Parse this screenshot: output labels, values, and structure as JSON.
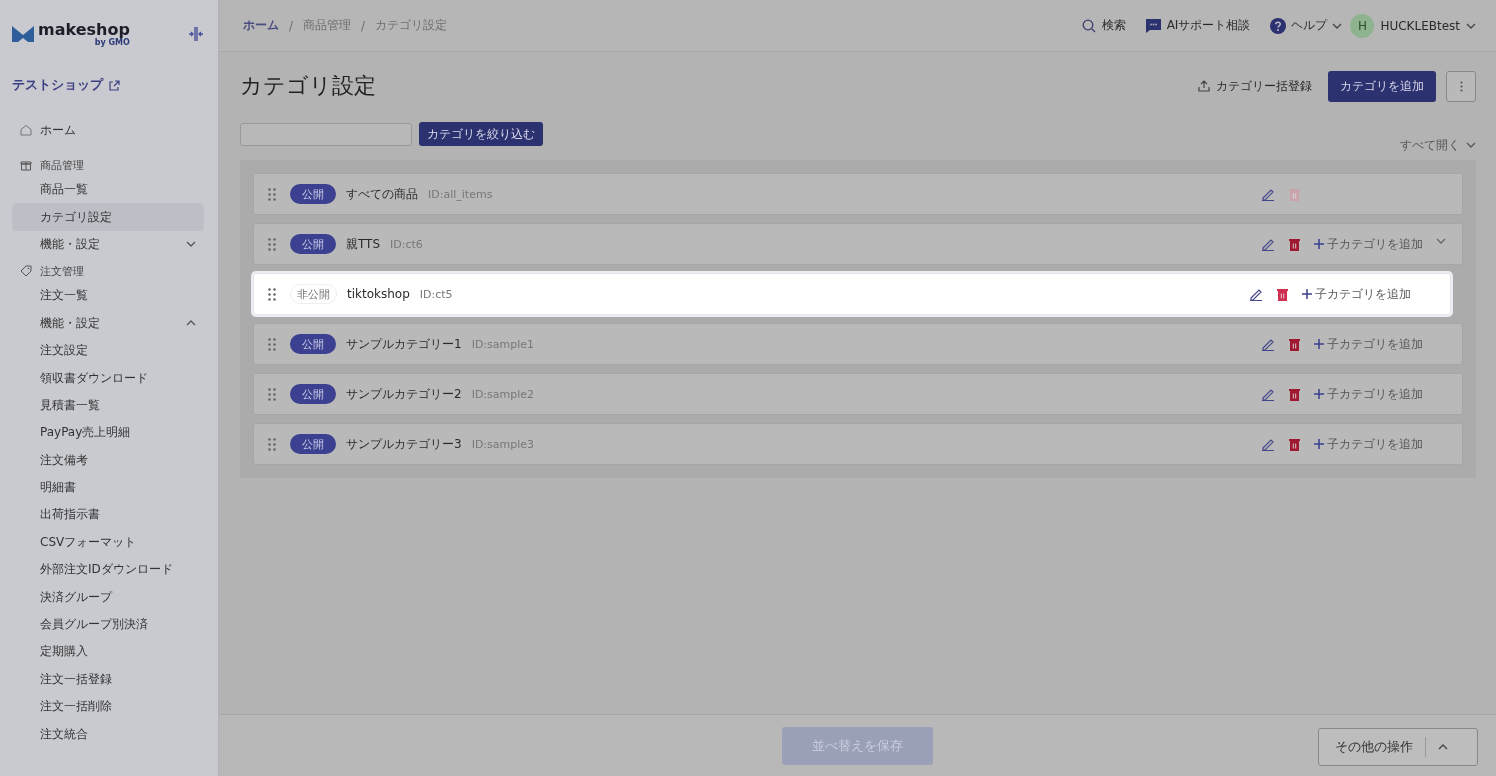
{
  "sidebar": {
    "logo": "makeshop",
    "logo_sub": "by GMO",
    "shop_name": "テストショップ",
    "items": [
      {
        "kind": "top",
        "label": "ホーム",
        "selected": false
      },
      {
        "kind": "heading",
        "label": "商品管理"
      },
      {
        "kind": "item",
        "label": "商品一覧",
        "selected": false
      },
      {
        "kind": "item",
        "label": "カテゴリ設定",
        "selected": true
      },
      {
        "kind": "toggle",
        "label": "機能・設定",
        "expanded": false
      },
      {
        "kind": "heading",
        "label": "注文管理"
      },
      {
        "kind": "item",
        "label": "注文一覧",
        "selected": false
      },
      {
        "kind": "toggle",
        "label": "機能・設定",
        "expanded": true
      },
      {
        "kind": "item",
        "label": "注文設定",
        "selected": false
      },
      {
        "kind": "item",
        "label": "領収書ダウンロード",
        "selected": false
      },
      {
        "kind": "item",
        "label": "見積書一覧",
        "selected": false
      },
      {
        "kind": "item",
        "label": "PayPay売上明細",
        "selected": false
      },
      {
        "kind": "item",
        "label": "注文備考",
        "selected": false
      },
      {
        "kind": "item",
        "label": "明細書",
        "selected": false
      },
      {
        "kind": "item",
        "label": "出荷指示書",
        "selected": false
      },
      {
        "kind": "item",
        "label": "CSVフォーマット",
        "selected": false
      },
      {
        "kind": "item",
        "label": "外部注文IDダウンロード",
        "selected": false
      },
      {
        "kind": "item",
        "label": "決済グループ",
        "selected": false
      },
      {
        "kind": "item",
        "label": "会員グループ別決済",
        "selected": false
      },
      {
        "kind": "item",
        "label": "定期購入",
        "selected": false
      },
      {
        "kind": "item",
        "label": "注文一括登録",
        "selected": false
      },
      {
        "kind": "item",
        "label": "注文一括削除",
        "selected": false
      },
      {
        "kind": "item",
        "label": "注文統合",
        "selected": false
      }
    ]
  },
  "breadcrumbs": [
    "ホーム",
    "商品管理",
    "カテゴリ設定"
  ],
  "breadcrumb_separator": "/",
  "header": {
    "search": "検索",
    "ai_support": "AIサポート相談",
    "help": "ヘルプ",
    "avatar": "H",
    "user": "HUCKLEBtest"
  },
  "page": {
    "title": "カテゴリ設定",
    "bulk_register": "カテゴリー括登録",
    "add_button": "カテゴリを追加",
    "filter_button": "カテゴリを絞り込む",
    "expand_all": "すべて開く"
  },
  "categories": [
    {
      "status": "公開",
      "published": true,
      "name": "すべての商品",
      "id": "ID:all_items",
      "deletable": false,
      "expandable": false,
      "dragging": false
    },
    {
      "status": "公開",
      "published": true,
      "name": "親TTS",
      "id": "ID:ct6",
      "deletable": true,
      "add_child": "子カテゴリを追加",
      "expandable": true,
      "dragging": false
    },
    {
      "status": "非公開",
      "published": false,
      "name": "tiktokshop",
      "id": "ID:ct5",
      "deletable": true,
      "add_child": "子カテゴリを追加",
      "expandable": false,
      "dragging": true
    },
    {
      "status": "公開",
      "published": true,
      "name": "サンプルカテゴリー1",
      "id": "ID:sample1",
      "deletable": true,
      "add_child": "子カテゴリを追加",
      "expandable": false,
      "dragging": false
    },
    {
      "status": "公開",
      "published": true,
      "name": "サンプルカテゴリー2",
      "id": "ID:sample2",
      "deletable": true,
      "add_child": "子カテゴリを追加",
      "expandable": false,
      "dragging": false
    },
    {
      "status": "公開",
      "published": true,
      "name": "サンプルカテゴリー3",
      "id": "ID:sample3",
      "deletable": true,
      "add_child": "子カテゴリを追加",
      "expandable": false,
      "dragging": false
    }
  ],
  "footer": {
    "save": "並べ替えを保存",
    "save_disabled": true,
    "more": "その他の操作"
  }
}
